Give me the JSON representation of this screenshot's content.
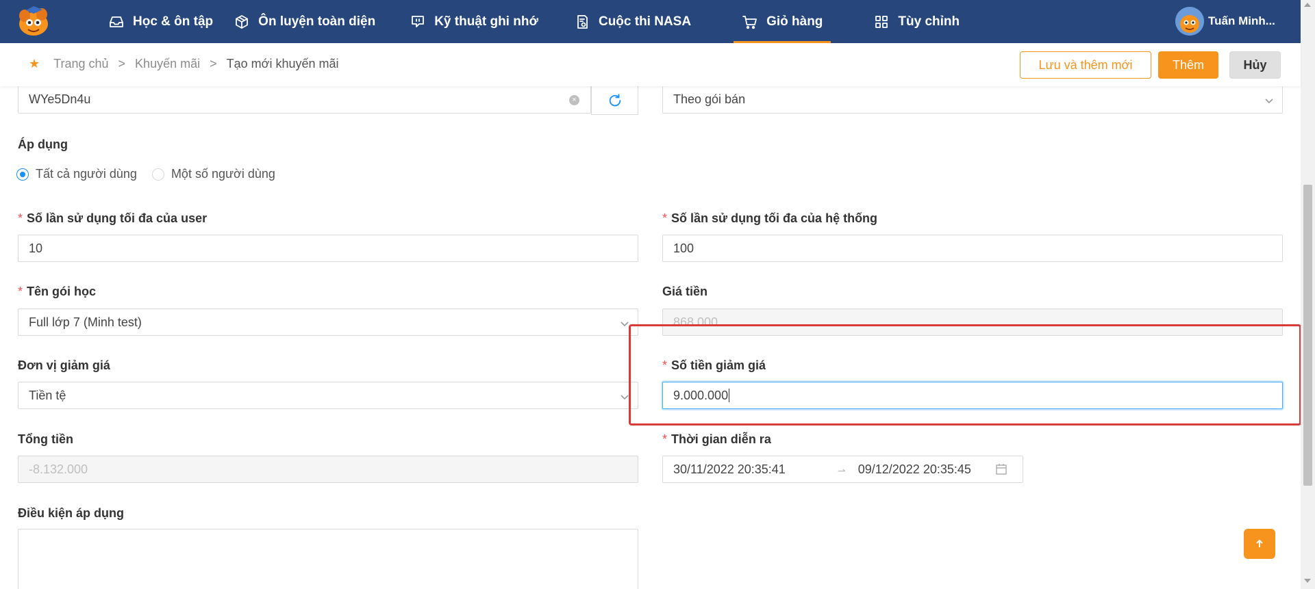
{
  "nav": {
    "items": [
      {
        "label": "Học & ôn tập",
        "icon": "inbox-icon"
      },
      {
        "label": "Ôn luyện toàn diện",
        "icon": "box-icon"
      },
      {
        "label": "Kỹ thuật ghi nhớ",
        "icon": "chat-icon"
      },
      {
        "label": "Cuộc thi NASA",
        "icon": "certificate-icon"
      },
      {
        "label": "Giỏ hàng",
        "icon": "cart-icon",
        "active": true
      },
      {
        "label": "Tùy chỉnh",
        "icon": "grid-icon"
      }
    ],
    "user_name": "Tuấn Minh...",
    "accent": "#f7941d",
    "background": "#27477c"
  },
  "breadcrumb": {
    "home": "Trang chủ",
    "section": "Khuyến mãi",
    "current": "Tạo mới khuyến mãi",
    "separator": ">"
  },
  "actions": {
    "save_add": "Lưu và thêm mới",
    "add": "Thêm",
    "cancel": "Hủy"
  },
  "form": {
    "code_value": "WYe5Dn4u",
    "type_value": "Theo gói bán",
    "apply_label": "Áp dụng",
    "apply_options": [
      "Tất cả người dùng",
      "Một số người dùng"
    ],
    "apply_selected": "Tất cả người dùng",
    "max_user_label": "Số lần sử dụng tối đa của user",
    "max_user_value": "10",
    "max_system_label": "Số lần sử dụng tối đa của hệ thống",
    "max_system_value": "100",
    "package_label": "Tên gói học",
    "package_value": "Full lớp 7 (Minh test)",
    "price_label": "Giá tiền",
    "price_value": "868.000",
    "unit_label": "Đơn vị giảm giá",
    "unit_value": "Tiền tệ",
    "discount_label": "Số tiền giảm giá",
    "discount_value": "9.000.000",
    "total_label": "Tổng tiền",
    "total_value": "-8.132.000",
    "time_label": "Thời gian diễn ra",
    "time_start": "30/11/2022 20:35:41",
    "time_end": "09/12/2022 20:35:45",
    "condition_label": "Điều kiện áp dụng"
  }
}
